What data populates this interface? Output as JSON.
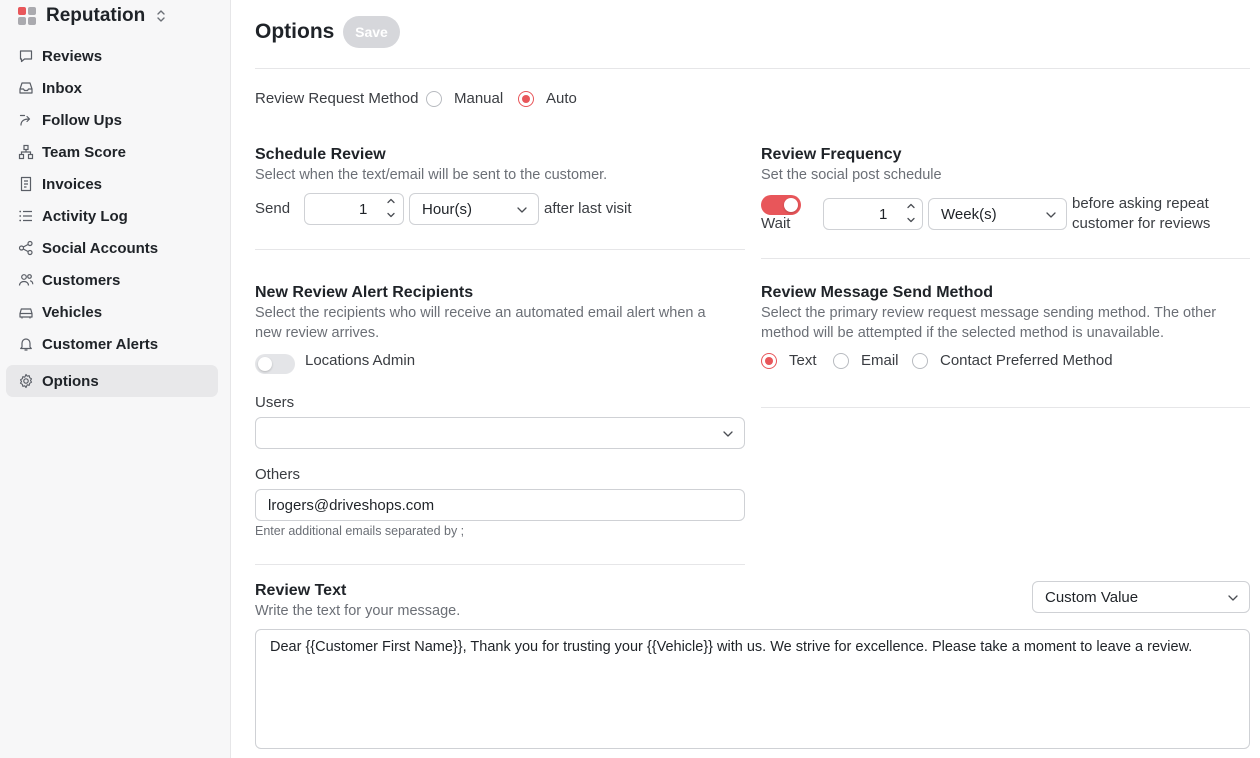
{
  "sidebar": {
    "title": "Reputation",
    "items": [
      {
        "label": "Reviews",
        "icon": "chat-bubble-icon"
      },
      {
        "label": "Inbox",
        "icon": "inbox-icon"
      },
      {
        "label": "Follow Ups",
        "icon": "follow-up-icon"
      },
      {
        "label": "Team Score",
        "icon": "org-chart-icon"
      },
      {
        "label": "Invoices",
        "icon": "invoice-icon"
      },
      {
        "label": "Activity Log",
        "icon": "list-icon"
      },
      {
        "label": "Social Accounts",
        "icon": "share-icon"
      },
      {
        "label": "Customers",
        "icon": "users-icon"
      },
      {
        "label": "Vehicles",
        "icon": "car-icon"
      },
      {
        "label": "Customer Alerts",
        "icon": "bell-icon"
      },
      {
        "label": "Options",
        "icon": "gear-icon",
        "active": true
      }
    ]
  },
  "header": {
    "title": "Options",
    "save_label": "Save"
  },
  "request_method": {
    "label": "Review Request Method",
    "options": [
      "Manual",
      "Auto"
    ],
    "selected": "Auto"
  },
  "schedule": {
    "title": "Schedule Review",
    "desc": "Select when the text/email will be sent to the customer.",
    "send_label": "Send",
    "amount": "1",
    "unit": "Hour(s)",
    "after_label": "after last visit"
  },
  "frequency": {
    "title": "Review Frequency",
    "desc": "Set the social post schedule",
    "wait_label": "Wait",
    "wait_enabled": true,
    "amount": "1",
    "unit": "Week(s)",
    "after_label_1": "before asking repeat",
    "after_label_2": "customer for reviews"
  },
  "alerts": {
    "title": "New Review Alert Recipients",
    "desc_1": "Select the recipients who will receive an automated email alert when a",
    "desc_2": "new review arrives.",
    "locations_admin_label": "Locations Admin",
    "locations_admin_enabled": false,
    "users_label": "Users",
    "users_value": "",
    "others_label": "Others",
    "others_value": "lrogers@driveshops.com",
    "others_hint": "Enter additional emails separated by ;"
  },
  "send_method": {
    "title": "Review Message Send Method",
    "desc_1": "Select the primary review request message sending method. The other",
    "desc_2": "method will be attempted if the selected method is unavailable.",
    "options": [
      "Text",
      "Email",
      "Contact Preferred Method"
    ],
    "selected": "Text"
  },
  "review_text": {
    "title": "Review Text",
    "desc": "Write the text for your message.",
    "custom_value_label": "Custom Value",
    "message": "Dear {{Customer First Name}}, Thank you for trusting your {{Vehicle}} with us. We strive for excellence. Please take a moment to leave a review."
  },
  "colors": {
    "accent": "#e8565a",
    "sidebar_bg": "#f7f7f8",
    "save_disabled": "#d6d7db"
  }
}
